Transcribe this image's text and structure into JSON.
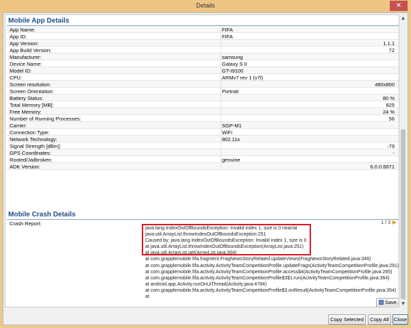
{
  "window": {
    "title": "Details",
    "close_glyph": "✕"
  },
  "app_section": {
    "title": "Mobile App Details"
  },
  "app_rows": [
    {
      "label": "App Name:",
      "value": "FIFA",
      "align": "left"
    },
    {
      "label": "App ID:",
      "value": "FIFA",
      "align": "left"
    },
    {
      "label": "App Version:",
      "value": "1.1.1",
      "align": "right"
    },
    {
      "label": "App Build Version:",
      "value": "72",
      "align": "right"
    },
    {
      "label": "Manufacturer:",
      "value": "samsung",
      "align": "left"
    },
    {
      "label": "Device Name:",
      "value": "Galaxy S II",
      "align": "left"
    },
    {
      "label": "Model ID:",
      "value": "GT-I9100",
      "align": "left"
    },
    {
      "label": "CPU:",
      "value": "ARMv7 rev 1 (v7l)",
      "align": "left"
    },
    {
      "label": "Screen resolution:",
      "value": "480x800",
      "align": "right"
    },
    {
      "label": "Screen Orientation:",
      "value": "Portrait",
      "align": "left"
    },
    {
      "label": "Battery Status:",
      "value": "80 %",
      "align": "right"
    },
    {
      "label": "Total Memory [MB]:",
      "value": "825",
      "align": "right"
    },
    {
      "label": "Free Memory:",
      "value": "24 %",
      "align": "right"
    },
    {
      "label": "Number of Running Processes:",
      "value": "56",
      "align": "right"
    },
    {
      "label": "Carrier:",
      "value": "SGP-M1",
      "align": "left"
    },
    {
      "label": "Connection Type:",
      "value": "WiFi",
      "align": "left"
    },
    {
      "label": "Network Technology:",
      "value": "802.11x",
      "align": "left"
    },
    {
      "label": "Signal Strength [dBm]:",
      "value": "-79",
      "align": "right"
    },
    {
      "label": "GPS Coordinates:",
      "value": "-",
      "align": "right"
    },
    {
      "label": "Rooted/Jailbroken:",
      "value": "genuine",
      "align": "left"
    },
    {
      "label": "ADK Version:",
      "value": "6.0.0.6671",
      "align": "right"
    }
  ],
  "crash_section": {
    "title": "Mobile Crash Details",
    "label": "Crash Report:",
    "pager": "1 / 2",
    "pager_icon": "next-arrow-icon",
    "lines": [
      "java.lang.IndexOutOfBoundsException: Invalid index 1, size is 0 near/at",
      "java.util.ArrayList.throwIndexOutOfBoundsException:251",
      "Caused by: java.lang.IndexOutOfBoundsException: Invalid index 1, size is 0",
      "   at java.util.ArrayList.throwIndexOutOfBoundsException(ArrayList.java:251)",
      "   at java.util.ArrayList.get(ArrayList.java:304)",
      "   at com.grapplemobile.fifa.fragment.FragNewsStoryRelated.updateViews(FragNewsStoryRelated.java:346)",
      "   at com.grapplemobile.fifa.activity.ActivityTeamCompetitionProfile.updateFrags(ActivityTeamCompetitionProfile.java:291)",
      "   at com.grapplemobile.fifa.activity.ActivityTeamCompetitionProfile.access$4(ActivityTeamCompetitionProfile.java:285)",
      "   at com.grapplemobile.fifa.activity.ActivityTeamCompetitionProfile$3$1.run(ActivityTeamCompetitionProfile.java:364)",
      "   at android.app.Activity.runOnUiThread(Activity.java:4784)",
      "   at com.grapplemobile.fifa.activity.ActivityTeamCompetitionProfile$3.onResult(ActivityTeamCompetitionProfile.java:354)",
      "   at"
    ],
    "save_label": "Save..."
  },
  "buttons": {
    "copy_selected": "Copy Selected",
    "copy_all": "Copy All",
    "close": "Close"
  },
  "colors": {
    "accent": "#1e4e8c",
    "highlight_border": "#e0141e",
    "frame": "#ecc98c"
  }
}
